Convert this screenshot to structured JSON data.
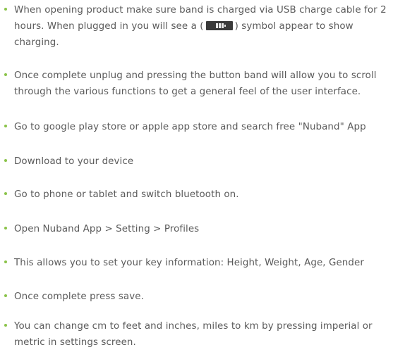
{
  "colors": {
    "bullet": "#8bc34a",
    "text": "#5a5a5a",
    "icon": "#3a3a3a"
  },
  "items": [
    {
      "before": "When opening product make sure band is charged via USB charge cable for 2 hours. When plugged in you will see a (",
      "icon": "battery-charging-icon",
      "after": ") symbol appear to show charging."
    },
    {
      "text": "Once complete unplug and pressing the button band will allow you to scroll through the various functions to get a general feel of the user interface."
    },
    {
      "text": "Go to google play store or apple app store and search free \"Nuband\" App"
    },
    {
      "text": "Download to your device"
    },
    {
      "text": "Go to phone or tablet and switch bluetooth on."
    },
    {
      "text": "Open Nuband App > Setting > Profiles"
    },
    {
      "text": "This allows you to set your key information: Height, Weight, Age, Gender"
    },
    {
      "text": "Once complete press save."
    },
    {
      "text": "You can change cm to feet and inches, miles to km by pressing imperial or metric in settings screen."
    }
  ]
}
